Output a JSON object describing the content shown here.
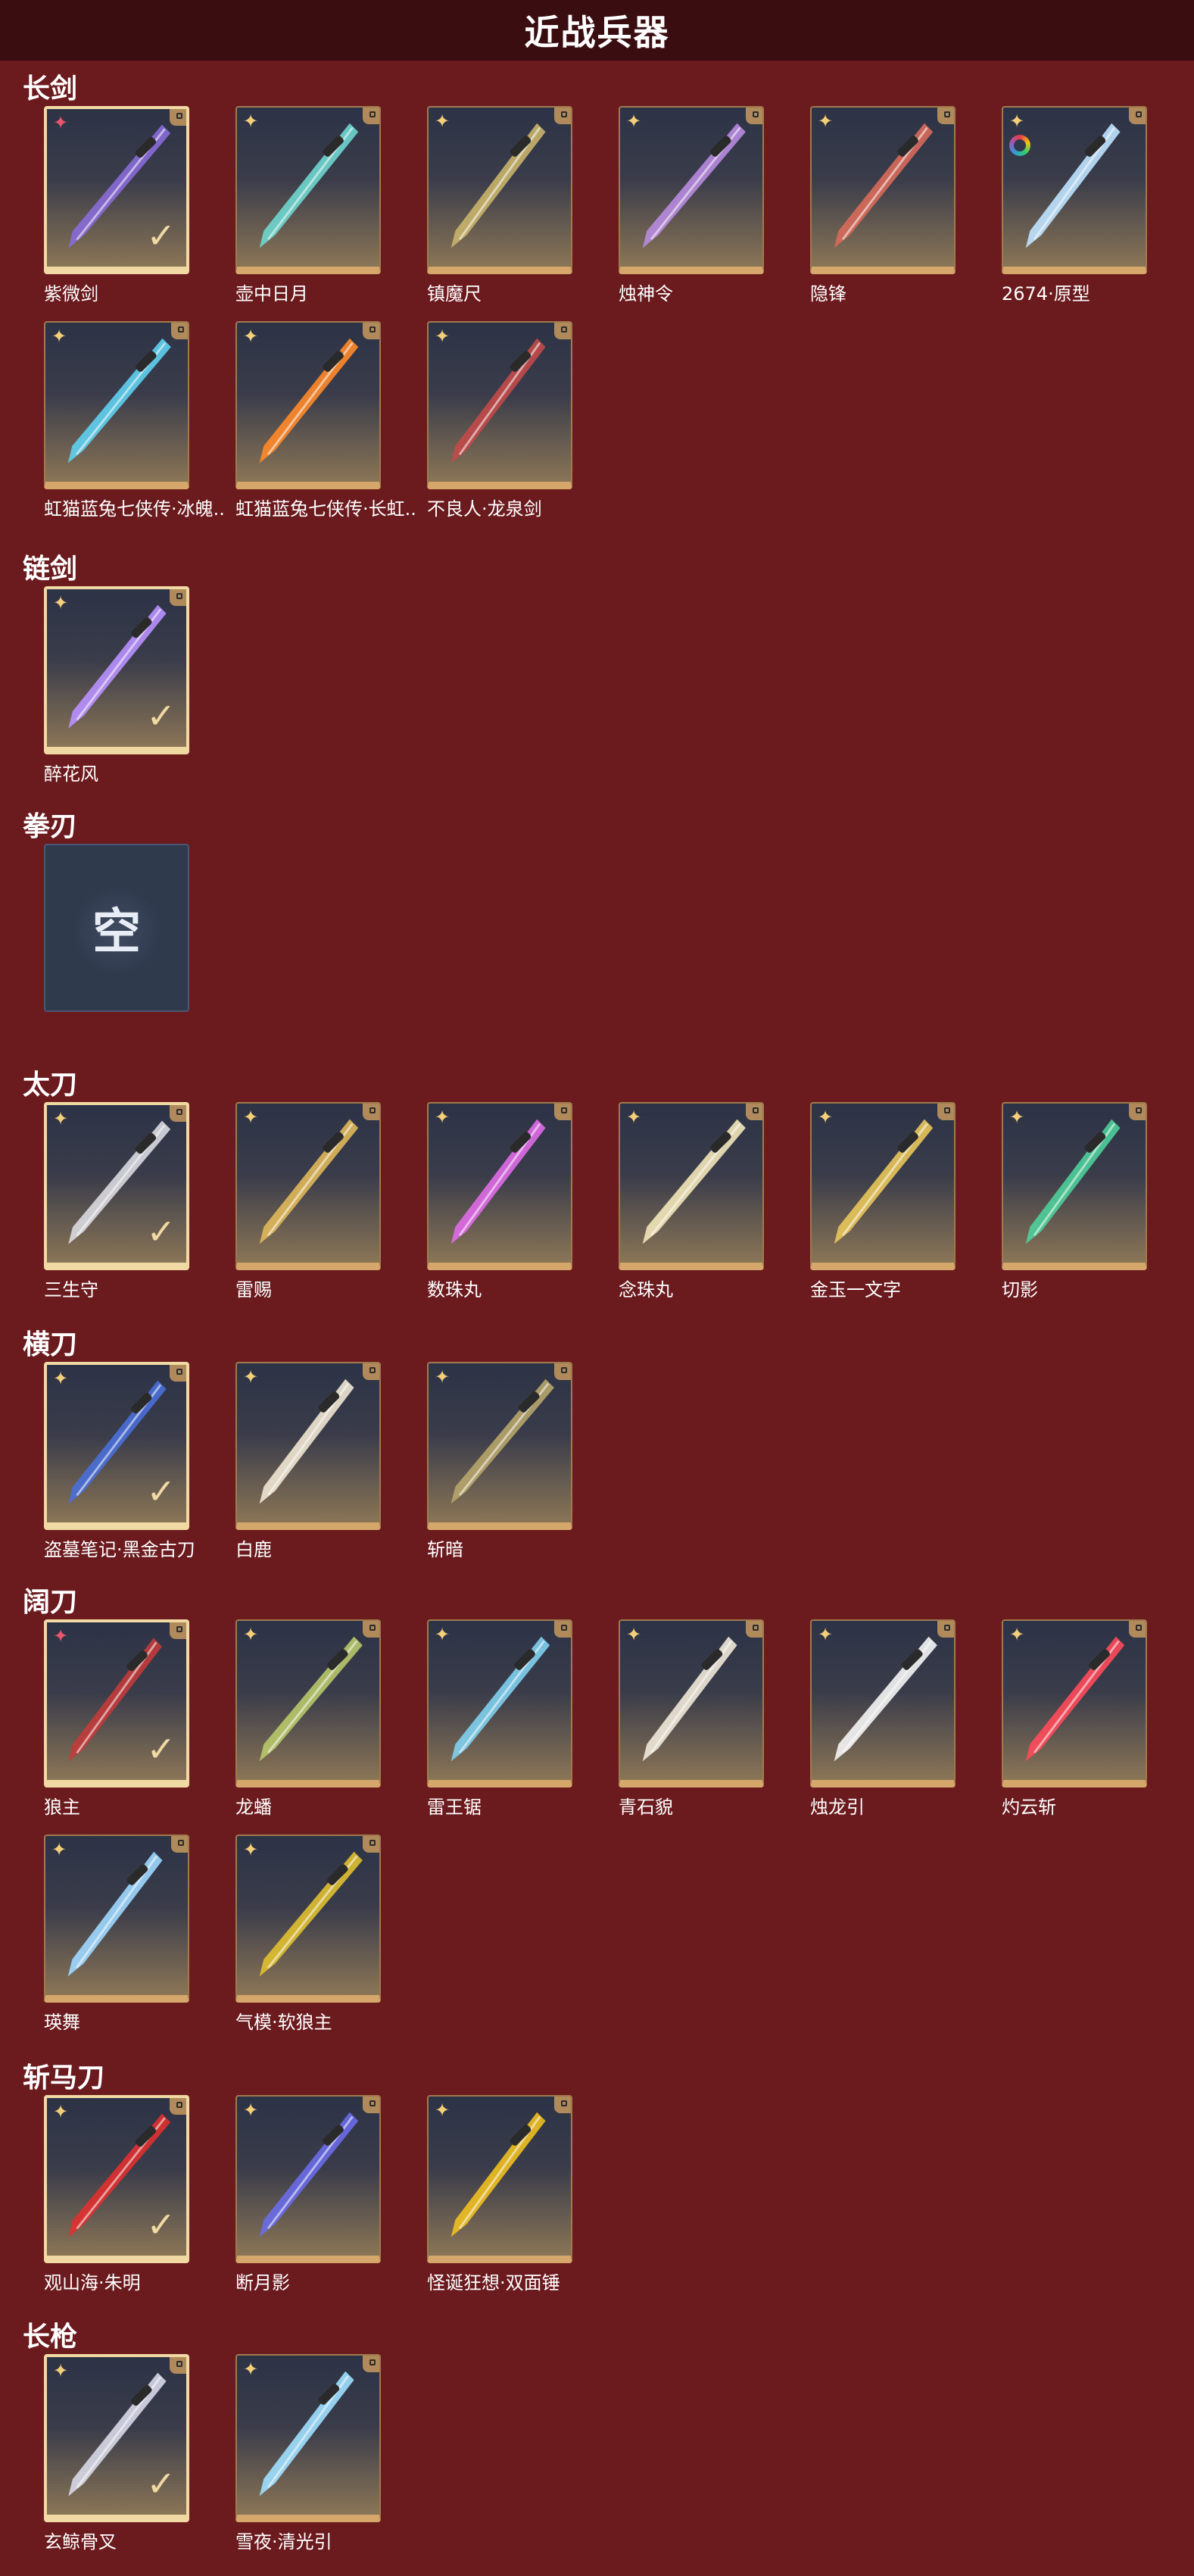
{
  "title": "近战兵器",
  "colors": {
    "background": "#6b1a1e",
    "header": "#3a0d11",
    "card_border": "#a07a4c",
    "selected_border": "#f1d9a3",
    "quality_gold": "#f3cf7a",
    "quality_red": "#e8566a"
  },
  "sections": [
    {
      "title": "长剑",
      "items": [
        {
          "name": "紫微剑",
          "quality": "red",
          "selected": true,
          "color": "#8a6bd8"
        },
        {
          "name": "壶中日月",
          "quality": "gold",
          "selected": false,
          "color": "#6fd6cf"
        },
        {
          "name": "镇魔尺",
          "quality": "gold",
          "selected": false,
          "color": "#c9b46a"
        },
        {
          "name": "烛神令",
          "quality": "gold",
          "selected": false,
          "color": "#b88be0"
        },
        {
          "name": "隐锋",
          "quality": "gold",
          "selected": false,
          "color": "#d86a5a"
        },
        {
          "name": "2674·原型",
          "quality": "gold",
          "selected": false,
          "color": "#bfe3ff",
          "ring": true
        },
        {
          "name": "虹猫蓝兔七侠传·冰魄..",
          "quality": "gold",
          "selected": false,
          "color": "#5fd0f0"
        },
        {
          "name": "虹猫蓝兔七侠传·长虹..",
          "quality": "gold",
          "selected": false,
          "color": "#ff8a2a"
        },
        {
          "name": "不良人·龙泉剑",
          "quality": "gold",
          "selected": false,
          "color": "#c24a4a"
        }
      ]
    },
    {
      "title": "链剑",
      "items": [
        {
          "name": "醉花风",
          "quality": "gold",
          "selected": true,
          "color": "#b991ff"
        }
      ]
    },
    {
      "title": "拳刃",
      "items": [
        {
          "name": "",
          "empty": true,
          "empty_text": "空"
        }
      ]
    },
    {
      "title": "太刀",
      "items": [
        {
          "name": "三生守",
          "quality": "gold",
          "selected": true,
          "color": "#d9d9e0"
        },
        {
          "name": "雷赐",
          "quality": "gold",
          "selected": false,
          "color": "#e0b85a"
        },
        {
          "name": "数珠丸",
          "quality": "gold",
          "selected": false,
          "color": "#e06be8"
        },
        {
          "name": "念珠丸",
          "quality": "gold",
          "selected": false,
          "color": "#f2e6b8"
        },
        {
          "name": "金玉一文字",
          "quality": "gold",
          "selected": false,
          "color": "#e9c75a"
        },
        {
          "name": "切影",
          "quality": "gold",
          "selected": false,
          "color": "#4ecf9a"
        }
      ]
    },
    {
      "title": "横刀",
      "items": [
        {
          "name": "盗墓笔记·黑金古刀",
          "quality": "gold",
          "selected": true,
          "color": "#4a6fd8"
        },
        {
          "name": "白鹿",
          "quality": "gold",
          "selected": false,
          "color": "#efe6d2"
        },
        {
          "name": "斩暗",
          "quality": "gold",
          "selected": false,
          "color": "#b7a56a"
        }
      ]
    },
    {
      "title": "阔刀",
      "items": [
        {
          "name": "狼主",
          "quality": "red",
          "selected": true,
          "color": "#c23b3b"
        },
        {
          "name": "龙蟠",
          "quality": "gold",
          "selected": false,
          "color": "#b8c86a"
        },
        {
          "name": "雷王锯",
          "quality": "gold",
          "selected": false,
          "color": "#7fd0f0"
        },
        {
          "name": "青石貌",
          "quality": "gold",
          "selected": false,
          "color": "#f0e8d8"
        },
        {
          "name": "烛龙引",
          "quality": "gold",
          "selected": false,
          "color": "#f5f5f5"
        },
        {
          "name": "灼云斩",
          "quality": "gold",
          "selected": false,
          "color": "#ff4a5a"
        },
        {
          "name": "瑛舞",
          "quality": "gold",
          "selected": false,
          "color": "#9fd8ff"
        },
        {
          "name": "气模·软狼主",
          "quality": "gold",
          "selected": false,
          "color": "#e0c030"
        }
      ]
    },
    {
      "title": "斩马刀",
      "items": [
        {
          "name": "观山海·朱明",
          "quality": "gold",
          "selected": true,
          "color": "#e03030"
        },
        {
          "name": "断月影",
          "quality": "gold",
          "selected": false,
          "color": "#6a6be8"
        },
        {
          "name": "怪诞狂想·双面锤",
          "quality": "gold",
          "selected": false,
          "color": "#f0c020"
        }
      ]
    },
    {
      "title": "长枪",
      "items": [
        {
          "name": "玄鲸骨叉",
          "quality": "gold",
          "selected": true,
          "color": "#d8d8e8"
        },
        {
          "name": "雪夜·清光引",
          "quality": "gold",
          "selected": false,
          "color": "#9fe0ff"
        }
      ]
    }
  ]
}
